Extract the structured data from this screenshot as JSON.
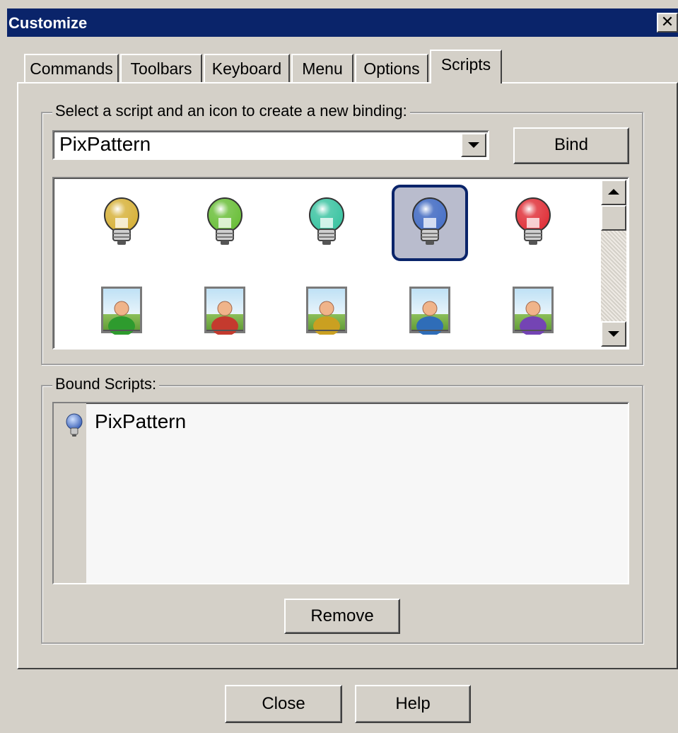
{
  "window": {
    "title": "Customize"
  },
  "tabs": [
    "Commands",
    "Toolbars",
    "Keyboard",
    "Menu",
    "Options",
    "Scripts"
  ],
  "active_tab": "Scripts",
  "binding_group": {
    "legend": "Select a script and an icon to create a new binding:",
    "script_select_value": "PixPattern",
    "bind_label": "Bind"
  },
  "icons": [
    {
      "name": "yellow-bulb-icon",
      "color": "#d7b23b"
    },
    {
      "name": "green-bulb-icon",
      "color": "#6bbf3a"
    },
    {
      "name": "teal-bulb-icon",
      "color": "#3cc4a2"
    },
    {
      "name": "blue-bulb-icon",
      "color": "#4a73c9",
      "selected": true
    },
    {
      "name": "red-bulb-icon",
      "color": "#e0323a"
    },
    {
      "name": "green-user-icon",
      "color": "#2e9b2e"
    },
    {
      "name": "red-user-icon",
      "color": "#c43a2e"
    },
    {
      "name": "yellow-user-icon",
      "color": "#caa021"
    },
    {
      "name": "blue-user-icon",
      "color": "#2f6db8"
    },
    {
      "name": "purple-user-icon",
      "color": "#7444b4"
    }
  ],
  "bound_group": {
    "legend": "Bound Scripts:",
    "items": [
      {
        "label": "PixPattern",
        "icon": "blue-bulb-icon"
      }
    ],
    "remove_label": "Remove"
  },
  "footer": {
    "close_label": "Close",
    "help_label": "Help"
  }
}
